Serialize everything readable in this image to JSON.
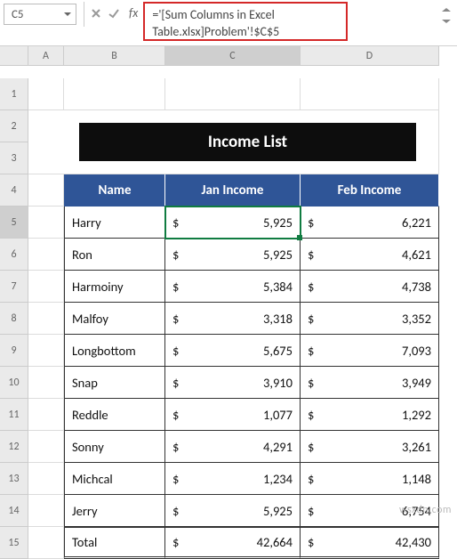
{
  "name_box": "C5",
  "formula_line1": "='[Sum Columns in Excel",
  "formula_line2": "Table.xlsx]Problem'!$C$5",
  "columns": [
    "A",
    "B",
    "C",
    "D"
  ],
  "row_numbers": [
    "1",
    "2",
    "3",
    "4",
    "5",
    "6",
    "7",
    "8",
    "9",
    "10",
    "11",
    "12",
    "13",
    "14",
    "15"
  ],
  "active_row": "5",
  "active_col": "C",
  "title": "Income List",
  "headers": {
    "name": "Name",
    "jan": "Jan Income",
    "feb": "Feb Income"
  },
  "rows": [
    {
      "name": "Harry",
      "jan": "5,925",
      "feb": "6,221"
    },
    {
      "name": "Ron",
      "jan": "5,925",
      "feb": "4,621"
    },
    {
      "name": "Harmoiny",
      "jan": "5,384",
      "feb": "4,738"
    },
    {
      "name": "Malfoy",
      "jan": "3,318",
      "feb": "3,352"
    },
    {
      "name": "Longbottom",
      "jan": "5,675",
      "feb": "7,093"
    },
    {
      "name": "Snap",
      "jan": "3,910",
      "feb": "3,949"
    },
    {
      "name": "Reddle",
      "jan": "1,077",
      "feb": "1,292"
    },
    {
      "name": "Sonny",
      "jan": "4,291",
      "feb": "3,261"
    },
    {
      "name": "Michcal",
      "jan": "1,234",
      "feb": "1,148"
    },
    {
      "name": "Jerry",
      "jan": "5,925",
      "feb": "6,754"
    }
  ],
  "total": {
    "label": "Total",
    "jan": "42,664",
    "feb": "42,430"
  },
  "currency": "$",
  "watermark": "wsxdn.com",
  "chart_data": {
    "type": "table",
    "title": "Income List",
    "columns": [
      "Name",
      "Jan Income",
      "Feb Income"
    ],
    "data": [
      [
        "Harry",
        5925,
        6221
      ],
      [
        "Ron",
        5925,
        4621
      ],
      [
        "Harmoiny",
        5384,
        4738
      ],
      [
        "Malfoy",
        3318,
        3352
      ],
      [
        "Longbottom",
        5675,
        7093
      ],
      [
        "Snap",
        3910,
        3949
      ],
      [
        "Reddle",
        1077,
        1292
      ],
      [
        "Sonny",
        4291,
        3261
      ],
      [
        "Michcal",
        1234,
        1148
      ],
      [
        "Jerry",
        5925,
        6754
      ]
    ],
    "totals": {
      "Jan Income": 42664,
      "Feb Income": 42430
    }
  }
}
